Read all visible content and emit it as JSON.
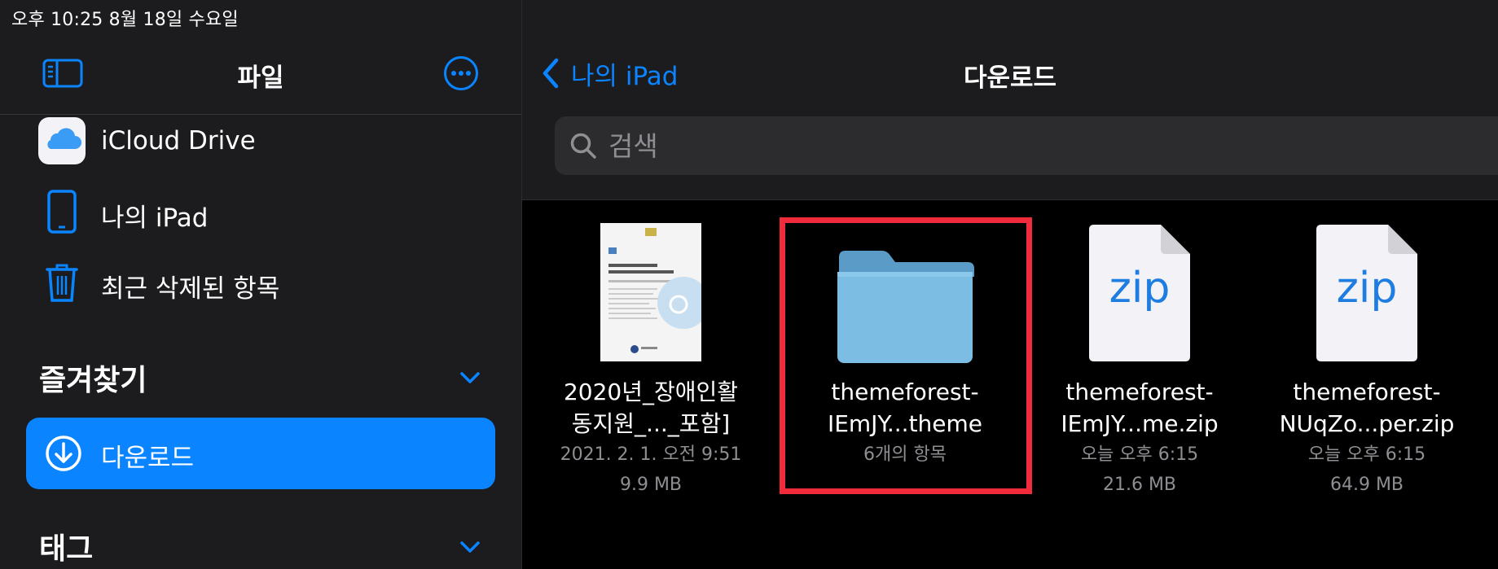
{
  "status_bar": {
    "time_date": "오후 10:25   8월 18일 수요일"
  },
  "sidebar": {
    "title": "파일",
    "locations": [
      {
        "label": "iCloud Drive",
        "icon": "icloud-icon"
      },
      {
        "label": "나의 iPad",
        "icon": "ipad-icon"
      },
      {
        "label": "최근 삭제된 항목",
        "icon": "trash-icon"
      }
    ],
    "favorites": {
      "title": "즐겨찾기",
      "items": [
        {
          "label": "다운로드",
          "icon": "download-icon",
          "selected": true
        }
      ]
    },
    "tags": {
      "title": "태그"
    }
  },
  "main": {
    "back_label": "나의 iPad",
    "title": "다운로드",
    "search": {
      "placeholder": "검색"
    },
    "files": [
      {
        "name_line1": "2020년_장애인활",
        "name_line2": "동지원_..._포함]",
        "date": "2021. 2. 1. 오전 9:51",
        "size": "9.9 MB",
        "type": "pdf"
      },
      {
        "name_line1": "themeforest-",
        "name_line2": "IEmJY...theme",
        "count": "6개의 항목",
        "type": "folder"
      },
      {
        "name_line1": "themeforest-",
        "name_line2": "IEmJY...me.zip",
        "date": "오늘 오후 6:15",
        "size": "21.6 MB",
        "type": "zip",
        "badge": "zip"
      },
      {
        "name_line1": "themeforest-",
        "name_line2": "NUqZo...per.zip",
        "date": "오늘 오후 6:15",
        "size": "64.9 MB",
        "type": "zip",
        "badge": "zip"
      }
    ],
    "doc_thumb": {
      "year_title": "2020년",
      "subtitle": "장애인활동지원 사업안내"
    }
  },
  "colors": {
    "accent": "#0a84ff",
    "highlight": "#ef2b3c",
    "sidebar_bg": "#1c1c1e"
  }
}
